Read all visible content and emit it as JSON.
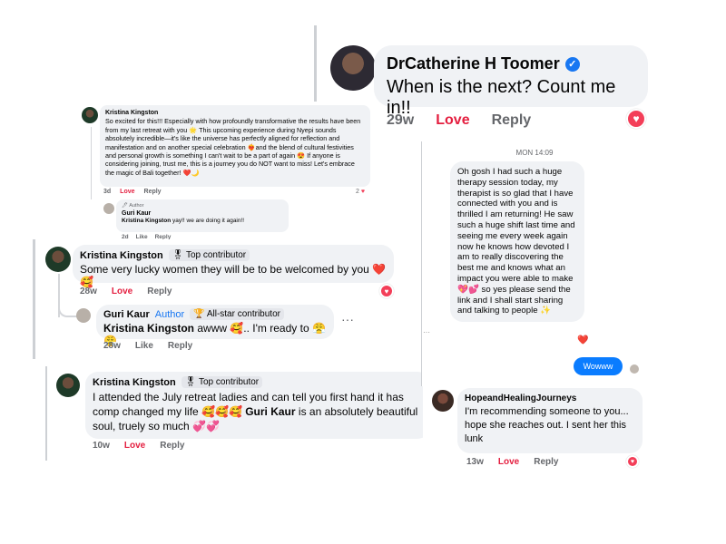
{
  "panel_catherine": {
    "name": "DrCatherine H Toomer",
    "verified_glyph": "✓",
    "text": "When is the next? Count me in!!",
    "time": "29w",
    "love": "Love",
    "reply": "Reply",
    "reaction_icon": "heart-icon"
  },
  "panel_kristina_long": {
    "name": "Kristina Kingston",
    "text": "So excited for this!!! Especially with how profoundly transformative the results have been from my last retreat with you 🌟 This upcoming experience during Nyepi sounds absolutely incredible—it's like the universe has perfectly aligned for reflection and manifestation and on another special celebration ❤️‍🔥and the blend of cultural festivities and personal growth is something I can't wait to be a part of again 😍 If anyone is considering joining, trust me, this is a journey you do NOT want to miss! Let's embrace the magic of Bali together! ❤️🌙",
    "time": "3d",
    "love": "Love",
    "reply": "Reply",
    "reaction_count": "2",
    "reply_comment": {
      "tag": "🖊 Author",
      "name": "Guri Kaur",
      "mention": "Kristina Kingston",
      "text": " yay!! we are doing it again!!",
      "time": "2d",
      "like": "Like",
      "reply": "Reply"
    }
  },
  "panel_kristina_guri": {
    "comment": {
      "name": "Kristina Kingston",
      "badge": "🎖 Top contributor",
      "text": "Some very lucky women they will be to be welcomed by you ❤️🥰",
      "time": "28w",
      "love": "Love",
      "reply": "Reply"
    },
    "reply": {
      "name": "Guri Kaur",
      "author": "Author",
      "badge": "🏆 All-star contributor",
      "mention": "Kristina Kingston",
      "text": " awww 🥰.. I'm ready to 😤 😤",
      "time": "28w",
      "like": "Like",
      "reply_label": "Reply",
      "more": "···"
    }
  },
  "panel_kristina_bottom": {
    "name": "Kristina Kingston",
    "badge": "🎖 Top contributor",
    "text_before": "I attended the July retreat ladies and can tell you first hand it has comp changed my life 🥰🥰🥰 ",
    "mention": "Guri Kaur",
    "text_after": " is an absolutely beautiful soul, truely so much 💞💞",
    "time": "10w",
    "love": "Love",
    "reply": "Reply"
  },
  "panel_messenger": {
    "date": "MON 14:09",
    "message": "Oh gosh I had such a huge therapy session today, my therapist is so glad that I have connected with you and is thrilled I am returning! He saw such a huge shift last time and seeing me every week again now he knows how devoted I am to really discovering the best me and knows what an impact you were able to make 💖💕 so yes please send the link and I shall start sharing and talking to people ✨",
    "reaction": "❤️",
    "outgoing": "Wowww"
  },
  "panel_hope": {
    "name": "HopeandHealingJourneys",
    "text": "I'm recommending someone to you... hope she reaches out. I sent her this lunk",
    "time": "13w",
    "love": "Love",
    "reply": "Reply"
  },
  "colors": {
    "love": "#e41e3f",
    "bubble": "#f0f2f5",
    "messenger_blue": "#0a7cff",
    "link_blue": "#1877f2"
  }
}
